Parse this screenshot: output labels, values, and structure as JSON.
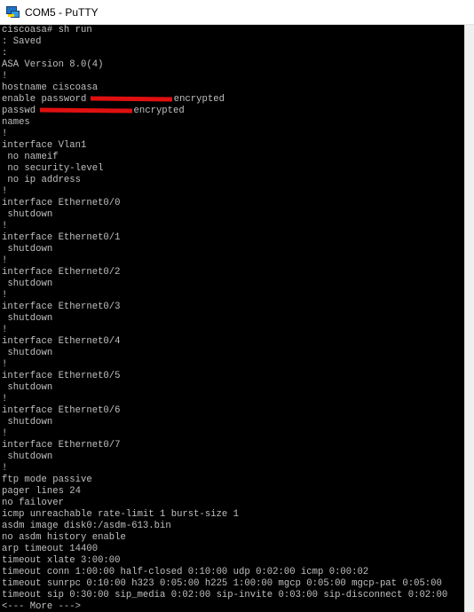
{
  "window": {
    "title": "COM5 - PuTTY"
  },
  "colors": {
    "terminal_bg": "#000000",
    "terminal_fg": "#c0c0c0",
    "cursor": "#00ff00",
    "redaction": "#e01010"
  },
  "icons": {
    "app_icon": "putty-icon"
  },
  "terminal": {
    "lines": [
      "ciscoasa# sh run",
      ": Saved",
      ":",
      "ASA Version 8.0(4)",
      "!",
      "hostname ciscoasa",
      "enable password ",
      "passwd ",
      "names",
      "!",
      "interface Vlan1",
      " no nameif",
      " no security-level",
      " no ip address",
      "!",
      "interface Ethernet0/0",
      " shutdown",
      "!",
      "interface Ethernet0/1",
      " shutdown",
      "!",
      "interface Ethernet0/2",
      " shutdown",
      "!",
      "interface Ethernet0/3",
      " shutdown",
      "!",
      "interface Ethernet0/4",
      " shutdown",
      "!",
      "interface Ethernet0/5",
      " shutdown",
      "!",
      "interface Ethernet0/6",
      " shutdown",
      "!",
      "interface Ethernet0/7",
      " shutdown",
      "!",
      "ftp mode passive",
      "pager lines 24",
      "no failover",
      "icmp unreachable rate-limit 1 burst-size 1",
      "asdm image disk0:/asdm-613.bin",
      "no asdm history enable",
      "arp timeout 14400",
      "timeout xlate 3:00:00",
      "timeout conn 1:00:00 half-closed 0:10:00 udp 0:02:00 icmp 0:00:02",
      "timeout sunrpc 0:10:00 h323 0:05:00 h225 1:00:00 mgcp 0:05:00 mgcp-pat 0:05:00",
      "timeout sip 0:30:00 sip_media 0:02:00 sip-invite 0:03:00 sip-disconnect 0:02:00",
      "<--- More --->"
    ],
    "redacted_suffix_enable": "encrypted",
    "redacted_suffix_passwd": "encrypted"
  }
}
